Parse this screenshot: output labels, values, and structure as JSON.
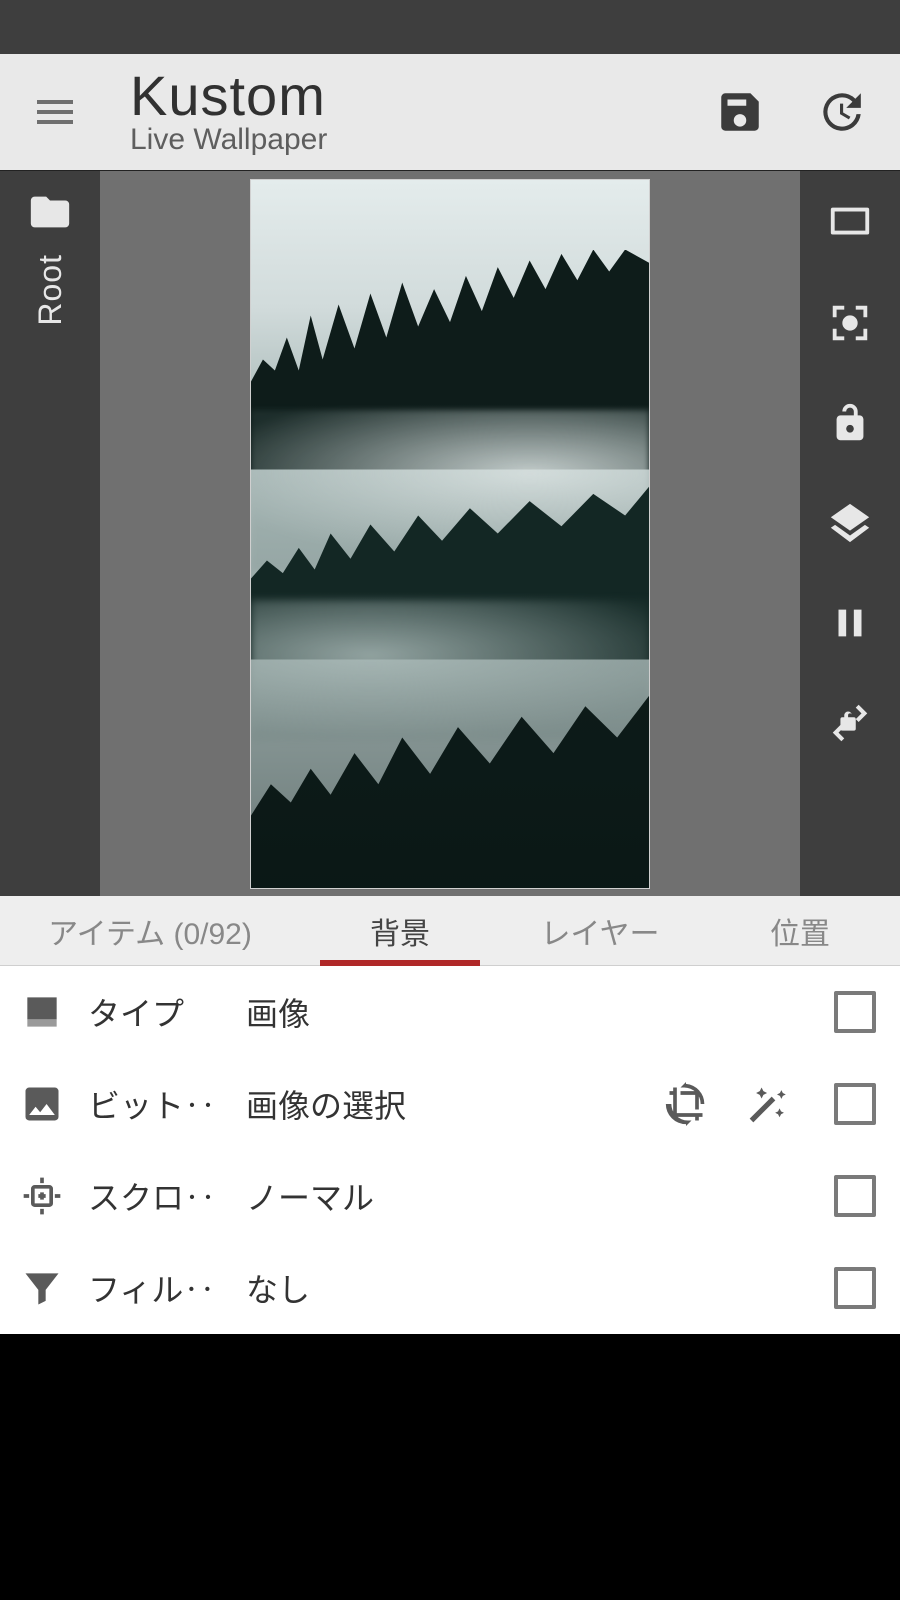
{
  "header": {
    "title": "Kustom",
    "subtitle": "Live Wallpaper"
  },
  "left_rail": {
    "label": "Root"
  },
  "tabs": [
    {
      "label": "アイテム (0/92)",
      "active": false
    },
    {
      "label": "背景",
      "active": true
    },
    {
      "label": "レイヤー",
      "active": false
    },
    {
      "label": "位置",
      "active": false
    }
  ],
  "rows": [
    {
      "icon": "image-type",
      "label": "タイプ",
      "value": "画像"
    },
    {
      "icon": "image",
      "label": "ビット‥",
      "value": "画像の選択",
      "actions": [
        "crop",
        "magic"
      ]
    },
    {
      "icon": "scroll",
      "label": "スクロ‥",
      "value": "ノーマル"
    },
    {
      "icon": "filter",
      "label": "フィル‥",
      "value": "なし"
    }
  ]
}
